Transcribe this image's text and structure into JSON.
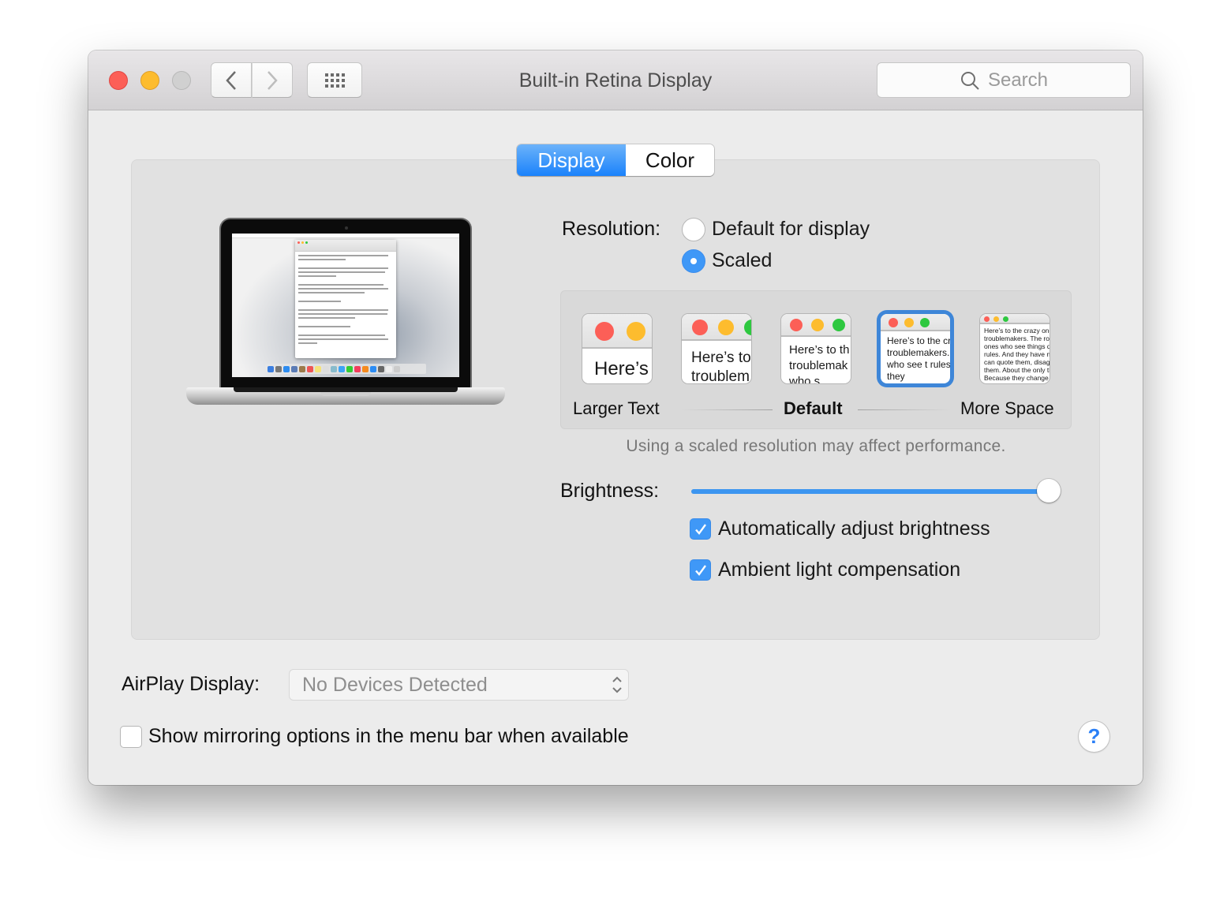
{
  "window": {
    "title": "Built-in Retina Display",
    "search_placeholder": "Search",
    "icons": {
      "close": "close-icon",
      "minimize": "minimize-icon",
      "zoom": "zoom-icon",
      "back": "chevron-left-icon",
      "forward": "chevron-right-icon",
      "show_all": "grid-icon",
      "search": "magnifier-icon"
    }
  },
  "tabs": [
    {
      "label": "Display",
      "active": true
    },
    {
      "label": "Color",
      "active": false
    }
  ],
  "resolution": {
    "label": "Resolution:",
    "options": [
      {
        "label": "Default for display",
        "selected": false
      },
      {
        "label": "Scaled",
        "selected": true
      }
    ],
    "scale_options": [
      {
        "preview_text": "Here’s",
        "selected": false
      },
      {
        "preview_text": "Here’s to troublem",
        "selected": false
      },
      {
        "preview_text": "Here’s to th troublemak ones who s",
        "selected": false
      },
      {
        "preview_text": "Here’s to the cr troublemakers. ones who see t rules. And they",
        "selected": true
      },
      {
        "preview_text": "Here’s to the crazy ones troublemakers. The rou ones who see things dif rules. And they have no can quote them, disagre them. About the only th Because they change t",
        "selected": false
      }
    ],
    "scale_labels": {
      "left": "Larger Text",
      "center": "Default",
      "right": "More Space"
    },
    "note": "Using a scaled resolution may affect performance."
  },
  "brightness": {
    "label": "Brightness:",
    "value_percent": 100,
    "auto_adjust": {
      "label": "Automatically adjust brightness",
      "checked": true
    },
    "ambient": {
      "label": "Ambient light compensation",
      "checked": true
    }
  },
  "airplay": {
    "label": "AirPlay Display:",
    "selected_value": "No Devices Detected"
  },
  "mirroring": {
    "label": "Show mirroring options in the menu bar when available",
    "checked": false
  },
  "help_label": "?",
  "colors": {
    "accent": "#3f98f7",
    "selection_ring": "#3e86d8",
    "close": "#fc5f57",
    "minimize": "#fdbc2e",
    "zoom_active": "#2ec840",
    "help_glyph": "#2a7ff6"
  }
}
